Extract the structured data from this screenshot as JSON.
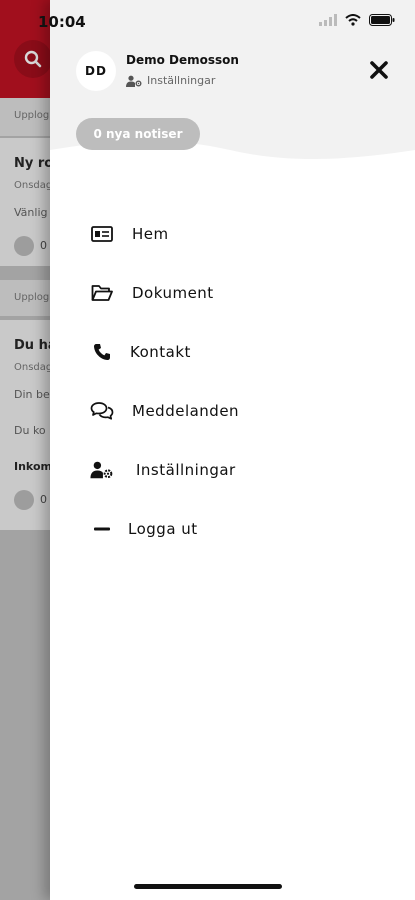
{
  "status_bar": {
    "time": "10:04"
  },
  "background": {
    "section_1": {
      "label": "Upplog"
    },
    "card_1": {
      "title": "Ny ro",
      "date": "Onsdag",
      "body": "Vänlig",
      "likes": "0"
    },
    "section_2": {
      "label": "Upplog"
    },
    "card_2": {
      "title": "Du ha",
      "date": "Onsdag",
      "body_1": "Din be",
      "body_2": "Du ko",
      "bold_line": "Inkom",
      "likes": "0"
    }
  },
  "drawer": {
    "user": {
      "initials": "DD",
      "name": "Demo Demosson",
      "settings_link": "Inställningar"
    },
    "notifications": {
      "label": "0 nya notiser"
    },
    "menu": [
      {
        "label": "Hem",
        "icon": "id-card-icon"
      },
      {
        "label": "Dokument",
        "icon": "folder-open-icon"
      },
      {
        "label": "Kontakt",
        "icon": "phone-icon"
      },
      {
        "label": "Meddelanden",
        "icon": "chat-bubbles-icon"
      },
      {
        "label": "Inställningar",
        "icon": "user-gear-icon"
      },
      {
        "label": "Logga ut",
        "icon": "minus-icon"
      }
    ]
  },
  "colors": {
    "brand": "#a10f1d",
    "pill": "#bdbdbd",
    "drawer_header": "#f2f2f2"
  }
}
